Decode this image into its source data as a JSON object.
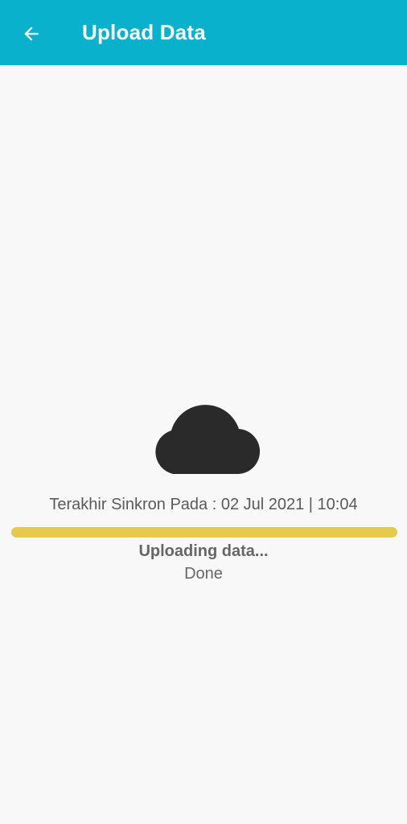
{
  "app_bar": {
    "title": "Upload Data",
    "back_icon": "arrow-left-icon",
    "color": "#0ab1cd"
  },
  "main": {
    "cloud_icon": "cloud-icon",
    "cloud_color": "#2a2a2a",
    "last_sync_text": "Terakhir Sinkron Pada : 02 Jul 2021 | 10:04",
    "progress": {
      "percent": 100,
      "color": "#e6c94f"
    },
    "status_title": "Uploading data...",
    "status_detail": "Done"
  }
}
